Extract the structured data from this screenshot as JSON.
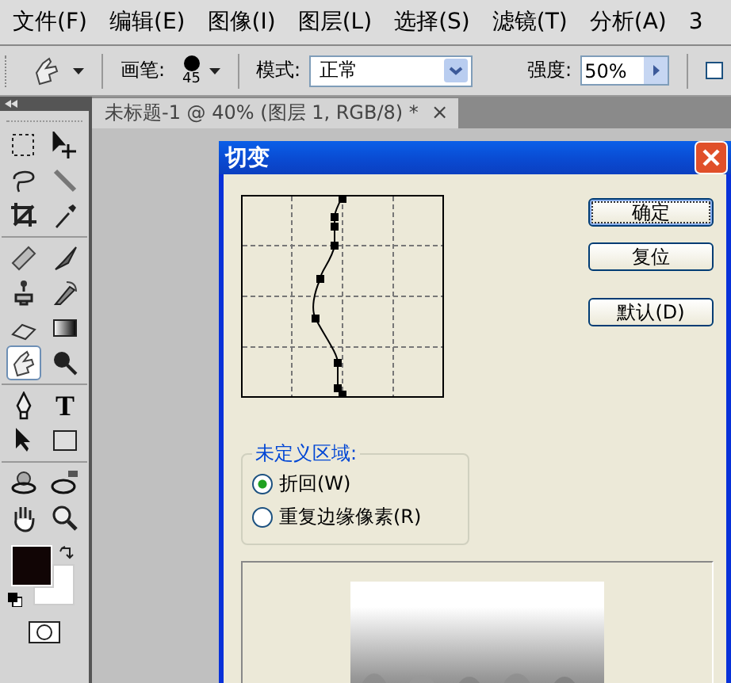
{
  "menu": [
    {
      "label": "文件(F)"
    },
    {
      "label": "编辑(E)"
    },
    {
      "label": "图像(I)"
    },
    {
      "label": "图层(L)"
    },
    {
      "label": "选择(S)"
    },
    {
      "label": "滤镜(T)"
    },
    {
      "label": "分析(A)"
    },
    {
      "label": "3"
    }
  ],
  "options": {
    "brush_label": "画笔:",
    "brush_size": "45",
    "mode_label": "模式:",
    "mode": "正常",
    "strength_label": "强度:",
    "strength": "50%",
    "checkbox_checked": false
  },
  "document_tab": {
    "title": "未标题-1 @ 40% (图层 1, RGB/8) *",
    "close": "×"
  },
  "toolbox": {
    "tools": [
      {
        "selected": false
      },
      {
        "selected": false
      },
      {
        "selected": false
      },
      {
        "selected": false
      },
      {
        "selected": false
      },
      {
        "selected": false
      },
      {
        "selected": false
      },
      {
        "selected": false
      },
      {
        "selected": false
      },
      {
        "selected": false
      },
      {
        "selected": false
      },
      {
        "selected": false
      },
      {
        "selected": true
      },
      {
        "selected": false
      },
      {
        "selected": false
      },
      {
        "selected": false,
        "glyph": "T"
      },
      {
        "selected": false
      },
      {
        "selected": false
      },
      {
        "selected": false
      },
      {
        "selected": false
      },
      {
        "selected": false
      },
      {
        "selected": false
      }
    ]
  },
  "dialog": {
    "title": "切变",
    "buttons": [
      {
        "label": "确定",
        "default": true
      },
      {
        "label": "复位",
        "default": false
      },
      {
        "label": "默认(D)",
        "default": false
      }
    ],
    "group": {
      "legend": "未定义区域:",
      "options": [
        {
          "label": "折回(W)",
          "selected": true
        },
        {
          "label": "重复边缘像素(R)",
          "selected": false
        }
      ]
    }
  }
}
